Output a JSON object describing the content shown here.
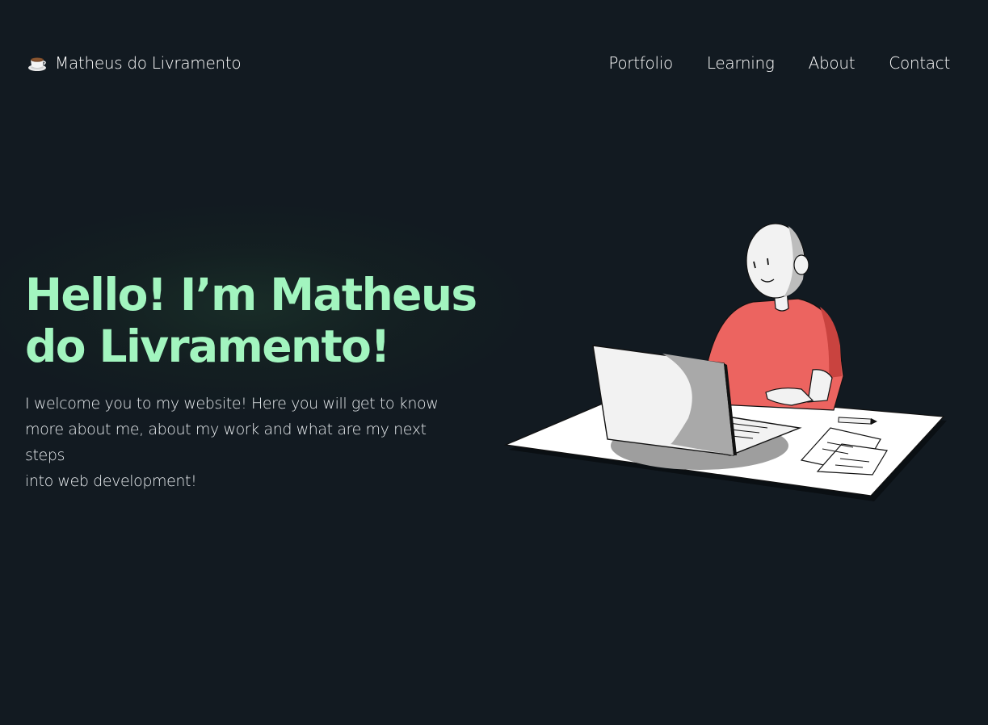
{
  "header": {
    "brand": {
      "icon": "coffee-cup-icon",
      "name": "Matheus do Livramento"
    },
    "nav": [
      {
        "label": "Portfolio"
      },
      {
        "label": "Learning"
      },
      {
        "label": "About"
      },
      {
        "label": "Contact"
      }
    ]
  },
  "hero": {
    "title_line1": "Hello! I’m Matheus",
    "title_line2": "do Livramento!",
    "intro_line1": "I welcome you to my website! Here you will get to know",
    "intro_line2": "more about me, about my work and what are my next steps",
    "intro_line3": "into web development!",
    "illustration": "person-at-laptop-illustration"
  },
  "colors": {
    "background": "#121a21",
    "accent": "#a2f5bf",
    "text": "#ffffff",
    "shirt": "#ec6460"
  }
}
